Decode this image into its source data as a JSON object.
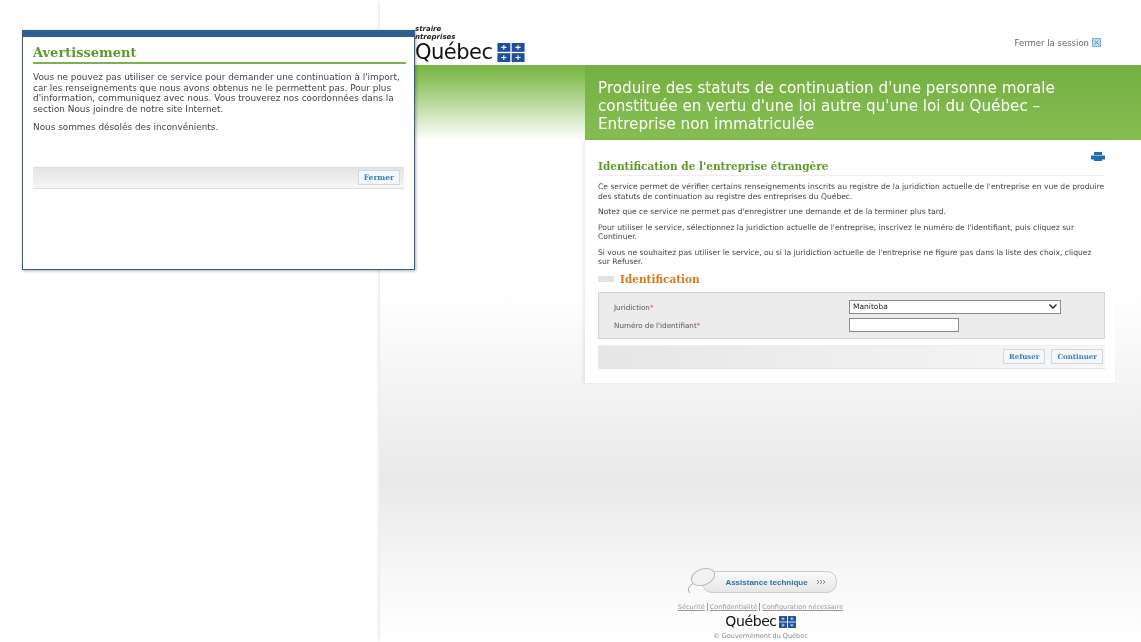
{
  "dialog": {
    "title": "Avertissement",
    "paragraphs": [
      "Vous ne pouvez pas utiliser ce service pour demander une continuation à l'import, car les renseignements que nous avons obtenus ne le permettent pas. Pour plus d'information, communiquez avec nous. Vous trouverez nos coordonnées dans la section Nous joindre de notre site Internet.",
      "Nous sommes désolés des inconvénients."
    ],
    "button": "Fermer"
  },
  "header": {
    "logo_lines": [
      "straire",
      "ntreprises"
    ],
    "logo_word": "Québec",
    "logout": "Fermer la session"
  },
  "banner": {
    "title_lines": [
      "Produire des statuts de continuation d'une personne morale",
      "constituée en vertu d'une loi autre qu'une loi du Québec –",
      "Entreprise non immatriculée"
    ]
  },
  "card": {
    "title": "Identification de l'entreprise étrangère",
    "paragraphs": [
      "Ce service permet de vérifier certains renseignements inscrits au registre de la juridiction actuelle de l'entreprise en vue de produire des statuts de continuation au registre des entreprises du Québec.",
      "Notez que ce service ne permet pas d'enregistrer une demande et de la terminer plus tard.",
      "Pour utiliser le service, sélectionnez la juridiction actuelle de l'entreprise, inscrivez le numéro de l'identifiant, puis cliquez sur Continuer.",
      "Si vous ne souhaitez pas utiliser le service, ou si la juridiction actuelle de l'entreprise ne figure pas dans la liste des choix, cliquez sur Refuser."
    ],
    "section": "Identification",
    "fields": [
      {
        "kind": "select",
        "label": "Juridiction",
        "required_mark": "*",
        "value": "Manitoba"
      },
      {
        "kind": "text",
        "label": "Numéro de l'identifiant",
        "required_mark": "*"
      }
    ],
    "buttons": [
      "Refuser",
      "Continuer"
    ]
  },
  "footer": {
    "assistance": "Assistance technique",
    "links": [
      "Sécurité",
      "Confidentialité",
      "Configuration nécessaire"
    ],
    "logo_word": "Québec",
    "copyright": "© Gouvernement du Québec"
  }
}
